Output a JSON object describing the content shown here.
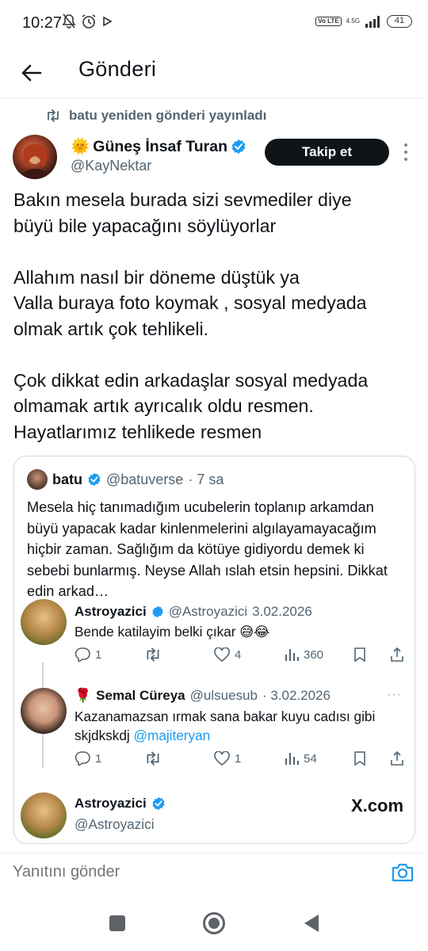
{
  "status_bar": {
    "time": "10:27",
    "network": "4.5G",
    "volte": "Vo LTE",
    "battery": "41"
  },
  "header": {
    "title": "Gönderi"
  },
  "repost": {
    "text": "batu yeniden gönderi yayınladı"
  },
  "post": {
    "author_name": "Güneş İnsaf Turan",
    "author_emoji": "🌞",
    "author_handle": "@KayNektar",
    "follow_label": "Takip et",
    "paragraph_1": "Bakın mesela burada sizi sevmediler diye\nbüyü bile yapacağını söylüyorlar",
    "paragraph_2": "Allahım nasıl bir döneme düştük ya\nValla buraya foto koymak , sosyal medyada\nolmak artık çok tehlikeli.",
    "paragraph_3": "Çok dikkat edin arkadaşlar sosyal medyada\nolmamak artık ayrıcalık oldu resmen.\nHayatlarımız tehlikede resmen"
  },
  "quote": {
    "author_name": "batu",
    "author_handle": "@batuverse",
    "time": "· 7 sa",
    "text": "Mesela hiç tanımadığım ucubelerin toplanıp arkamdan büyü yapacak kadar kinlenmelerini algılayamayacağım hiçbir zaman. Sağlığım da kötüye gidiyordu demek ki sebebi bunlarmış. Neyse Allah ıslah etsin hepsini. Dikkat edin arkad…"
  },
  "screenshot_replies": [
    {
      "name": "Astroyazici",
      "handle": "@Astroyazici",
      "date": "3.02.2026",
      "text": "Bende katilayim belki çıkar 😅😂",
      "replies": "1",
      "reposts": "",
      "likes": "4",
      "views": "360"
    },
    {
      "name": "Semal Cüreya",
      "name_emoji": "🌹",
      "handle": "@ulsuesub",
      "date": "· 3.02.2026",
      "text": "Kazanamazsan ırmak sana bakar kuyu cadısı gibi skjdkskdj",
      "mention": "@majiteryan",
      "replies": "1",
      "reposts": "",
      "likes": "1",
      "views": "54",
      "more": "···"
    },
    {
      "name": "Astroyazici",
      "handle": "@Astroyazici"
    }
  ],
  "watermark": "X.com",
  "composer": {
    "placeholder": "Yanıtını gönder"
  },
  "icons": {
    "back": "arrow-left-icon",
    "repost": "repost-icon",
    "verified": "verified-badge-icon",
    "camera": "camera-icon"
  },
  "colors": {
    "accent": "#1d9bf0",
    "text": "#0f1419",
    "muted": "#536471",
    "follow_bg": "#0f1419"
  }
}
